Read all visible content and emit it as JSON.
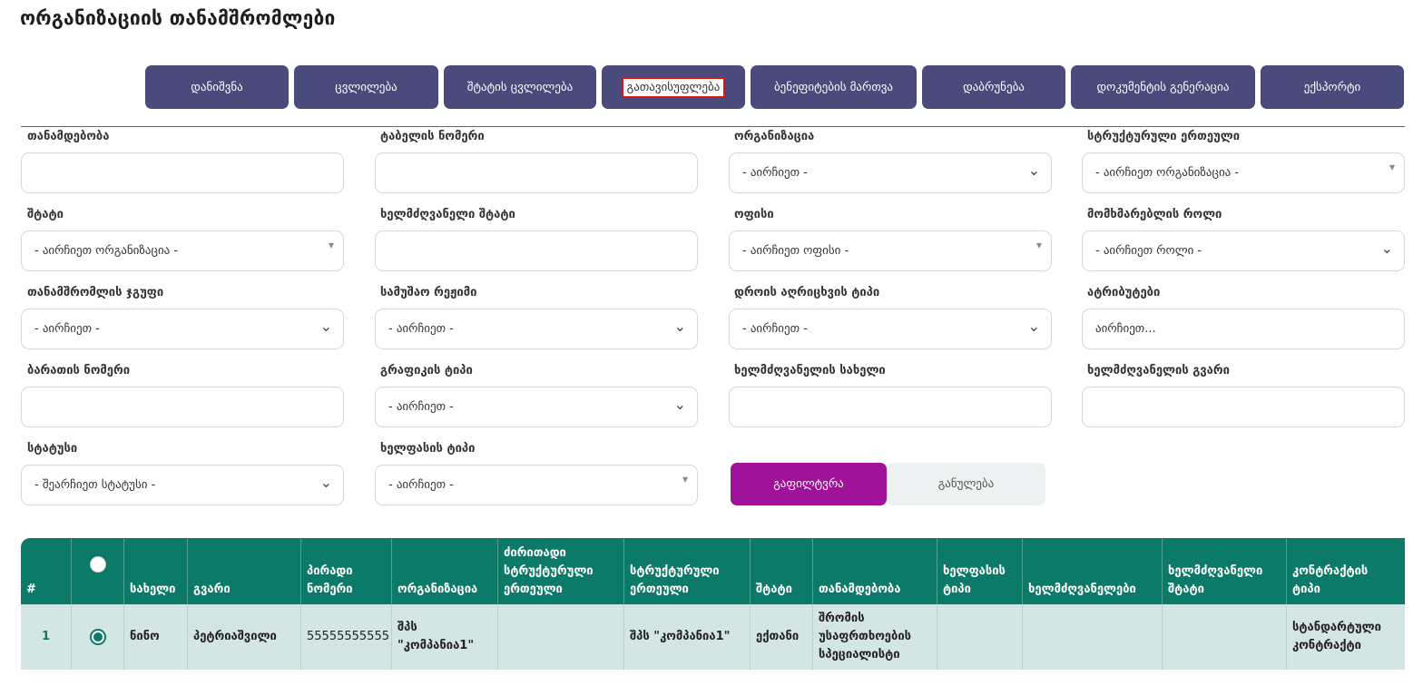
{
  "page": {
    "title": "ორგანიზაციის თანამშრომლები"
  },
  "toolbar": [
    {
      "label": "დანიშვნა"
    },
    {
      "label": "ცვლილება"
    },
    {
      "label": "შტატის ცვლილება"
    },
    {
      "label": "გათავისუფლება"
    },
    {
      "label": "ბენეფიტების მართვა"
    },
    {
      "label": "დაბრუნება"
    },
    {
      "label": "დოკუმენტის გენერაცია"
    },
    {
      "label": "ექსპორტი"
    }
  ],
  "filters": {
    "position": {
      "label": "თანამდებობა",
      "value": ""
    },
    "tab_number": {
      "label": "ტაბელის ნომერი",
      "value": ""
    },
    "organization": {
      "label": "ორგანიზაცია",
      "value": "- აირჩიეთ -"
    },
    "structural_unit": {
      "label": "სტრუქტურული ერთეული",
      "value": "- აირჩიეთ ორგანიზაცია -"
    },
    "staff": {
      "label": "შტატი",
      "value": "- აირჩიეთ ორგანიზაცია -"
    },
    "manager_staff": {
      "label": "ხელმძღვანელი შტატი",
      "value": ""
    },
    "office": {
      "label": "ოფისი",
      "value": "- აირჩიეთ ოფისი -"
    },
    "user_role": {
      "label": "მომხმარებლის როლი",
      "value": "- აირჩიეთ როლი -"
    },
    "employee_group": {
      "label": "თანამშრომლის ჯგუფი",
      "value": "- აირჩიეთ -"
    },
    "work_mode": {
      "label": "სამუშაო რეჟიმი",
      "value": "- აირჩიეთ -"
    },
    "time_tracking": {
      "label": "დროის აღრიცხვის ტიპი",
      "value": "- აირჩიეთ -"
    },
    "attributes": {
      "label": "ატრიბუტები",
      "placeholder": "აირჩიეთ..."
    },
    "card_number": {
      "label": "ბარათის ნომერი",
      "value": ""
    },
    "schedule_type": {
      "label": "გრაფიკის ტიპი",
      "value": "- აირჩიეთ -"
    },
    "manager_name": {
      "label": "ხელმძღვანელის სახელი",
      "value": ""
    },
    "manager_surname": {
      "label": "ხელმძღვანელის გვარი",
      "value": ""
    },
    "status": {
      "label": "სტატუსი",
      "value": "- შეარჩიეთ სტატუსი -"
    },
    "salary_type": {
      "label": "ხელფასის ტიპი",
      "value": "- აირჩიეთ -"
    },
    "filter_label": "გაფილტვრა",
    "reset_label": "განულება"
  },
  "table": {
    "headers": [
      "#",
      "",
      "სახელი",
      "გვარი",
      "პირადი ნომერი",
      "ორგანიზაცია",
      "ძირითადი სტრუქტურული ერთეული",
      "სტრუქტურული ერთეული",
      "შტატი",
      "თანამდებობა",
      "ხელფასის ტიპი",
      "ხელმძღვანელები",
      "ხელმძღვანელი შტატი",
      "კონტრაქტის ტიპი"
    ],
    "rows": [
      [
        "1",
        "",
        "ნინო",
        "პეტრიაშვილი",
        "55555555555",
        "შპს \"კომპანია1\"",
        "",
        "შპს \"კომპანია1\"",
        "ექთანი",
        "შრომის უსაფრთხოების სპეციალისტი",
        "",
        "",
        "",
        "სტანდარტული კონტრაქტი"
      ]
    ]
  },
  "colors": {
    "toolbar": "#4a4a7c",
    "table_header": "#0b7a68",
    "filter_button": "#a0129a"
  }
}
